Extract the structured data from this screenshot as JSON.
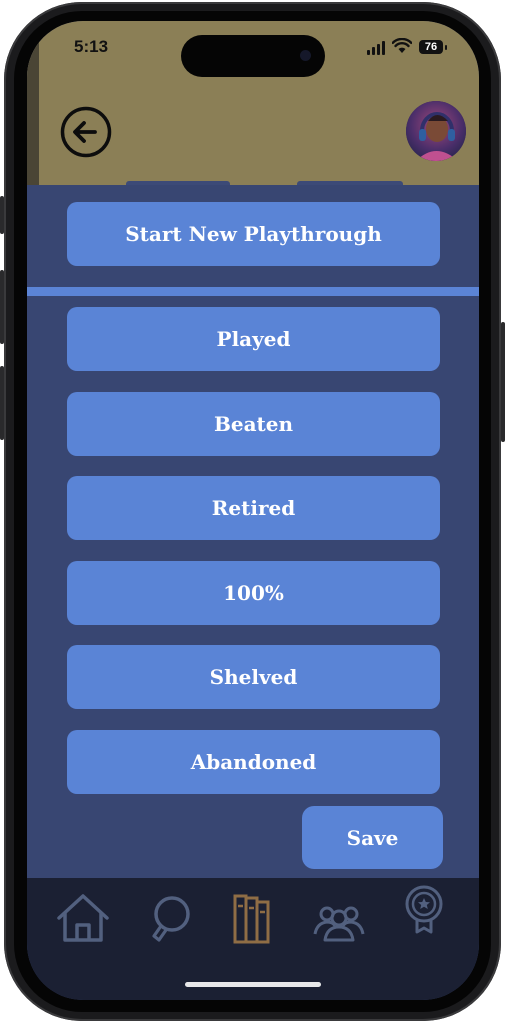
{
  "status_bar": {
    "time": "5:13",
    "battery": "76"
  },
  "header": {
    "back_icon": "arrow-left-circle-icon",
    "avatar_icon": "user-avatar"
  },
  "actions": {
    "start_playthrough": "Start New Playthrough",
    "statuses": [
      "Played",
      "Beaten",
      "Retired",
      "100%",
      "Shelved",
      "Abandoned"
    ],
    "save": "Save"
  },
  "tab_bar": {
    "items": [
      {
        "icon": "home-icon"
      },
      {
        "icon": "search-icon"
      },
      {
        "icon": "library-books-icon",
        "active": true
      },
      {
        "icon": "friends-group-icon"
      },
      {
        "icon": "award-badge-icon"
      }
    ]
  },
  "colors": {
    "header_bg": "#8b7f56",
    "panel_bg": "#384672",
    "button_bg": "#5a84d6",
    "tabbar_bg": "#1b2033",
    "tab_icon": "#52607f",
    "tab_icon_active": "#8f6d45"
  }
}
